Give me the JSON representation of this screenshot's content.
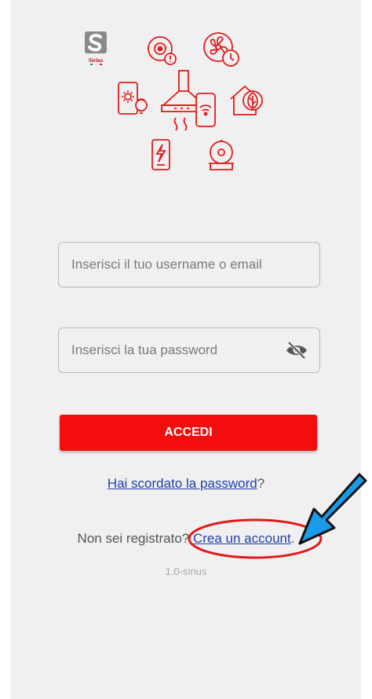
{
  "hero": {
    "brand_logo_text": "Sirius"
  },
  "login": {
    "username_placeholder": "Inserisci il tuo username o email",
    "password_placeholder": "Inserisci la tua password",
    "submit_label": "ACCEDI",
    "forgot_link": "Hai scordato la password",
    "forgot_suffix": "?",
    "register_prefix": "Non sei registrato? ",
    "register_link": "Crea un account",
    "register_suffix": ".",
    "version": "1.0-sirius"
  },
  "colors": {
    "accent": "#f40d0d",
    "link": "#1f3fa8",
    "annotation_arrow": "#1a9be8",
    "annotation_ellipse": "#e01a1a"
  }
}
